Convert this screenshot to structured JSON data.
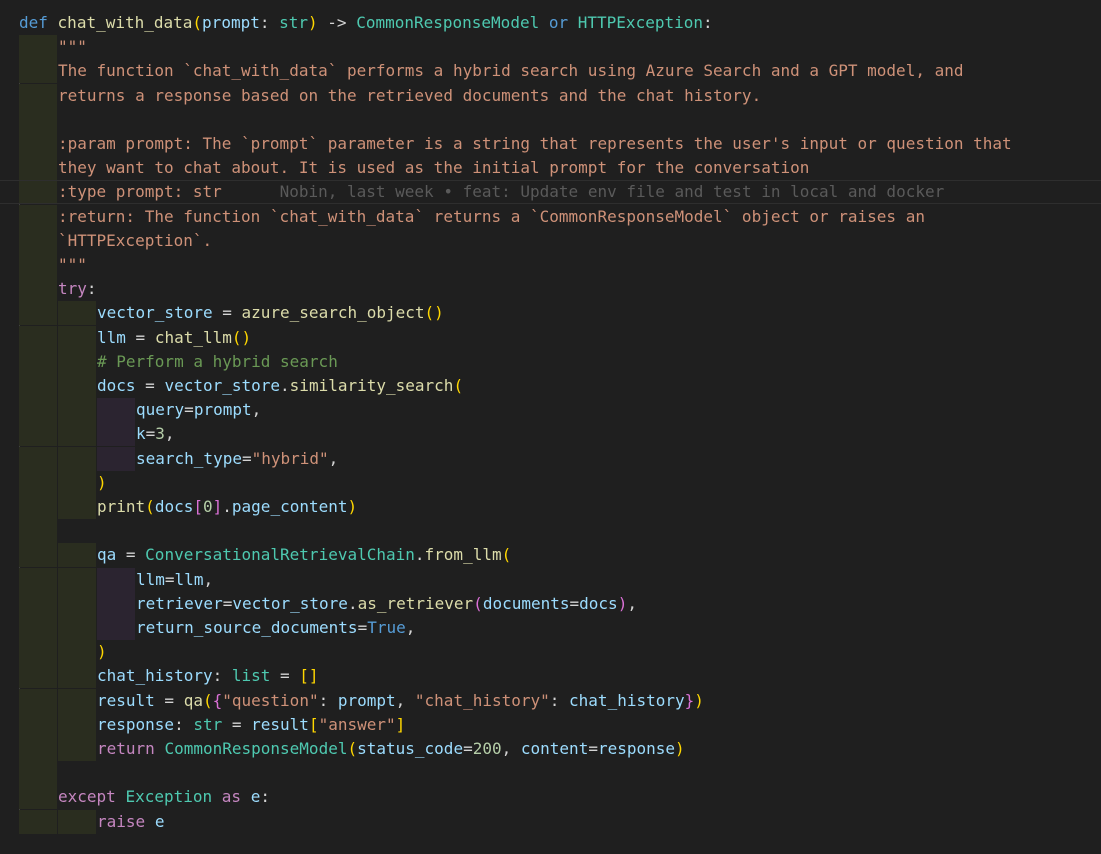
{
  "editor": {
    "language": "python",
    "lines": [
      {
        "indent": 0,
        "tokens": [
          [
            "def",
            "kw"
          ],
          [
            " "
          ],
          [
            "chat_with_data",
            "fn"
          ],
          [
            "(",
            "br1"
          ],
          [
            "prompt",
            "v"
          ],
          [
            ": "
          ],
          [
            "str",
            "cls"
          ],
          [
            ")",
            "br1"
          ],
          [
            " -> "
          ],
          [
            "CommonResponseModel",
            "cls"
          ],
          [
            " "
          ],
          [
            "or",
            "kw"
          ],
          [
            " "
          ],
          [
            "HTTPException",
            "cls"
          ],
          [
            ":"
          ]
        ]
      },
      {
        "indent": 1,
        "tokens": [
          [
            "\"\"\"",
            "str"
          ]
        ]
      },
      {
        "indent": 1,
        "tokens": [
          [
            "The function `chat_with_data` performs a hybrid search using Azure Search and a GPT model, and",
            "str"
          ]
        ]
      },
      {
        "indent": 1,
        "tokens": [
          [
            "returns a response based on the retrieved documents and the chat history.",
            "str"
          ]
        ]
      },
      {
        "indent": 1,
        "tokens": []
      },
      {
        "indent": 1,
        "tokens": [
          [
            ":param prompt: The `prompt` parameter is a string that represents the user's input or question that",
            "str"
          ]
        ]
      },
      {
        "indent": 1,
        "tokens": [
          [
            "they want to chat about. It is used as the initial prompt for the conversation",
            "str"
          ]
        ]
      },
      {
        "indent": 1,
        "current": true,
        "tokens": [
          [
            ":type prompt: str",
            "str"
          ],
          [
            "      Nobin, last week • feat: Update env file and test in local and docker",
            "blame"
          ]
        ]
      },
      {
        "indent": 1,
        "tokens": [
          [
            ":return: The function `chat_with_data` returns a `CommonResponseModel` object or raises an",
            "str"
          ]
        ]
      },
      {
        "indent": 1,
        "tokens": [
          [
            "`HTTPException`.",
            "str"
          ]
        ]
      },
      {
        "indent": 1,
        "tokens": [
          [
            "\"\"\"",
            "str"
          ]
        ]
      },
      {
        "indent": 1,
        "tokens": [
          [
            "try",
            "ctl"
          ],
          [
            ":"
          ]
        ]
      },
      {
        "indent": 2,
        "tokens": [
          [
            "vector_store",
            "v"
          ],
          [
            " = "
          ],
          [
            "azure_search_object",
            "fn"
          ],
          [
            "()",
            "br1"
          ]
        ]
      },
      {
        "indent": 2,
        "tokens": [
          [
            "llm",
            "v"
          ],
          [
            " = "
          ],
          [
            "chat_llm",
            "fn"
          ],
          [
            "()",
            "br1"
          ]
        ]
      },
      {
        "indent": 2,
        "tokens": [
          [
            "# Perform a hybrid search",
            "cm"
          ]
        ]
      },
      {
        "indent": 2,
        "tokens": [
          [
            "docs",
            "v"
          ],
          [
            " = "
          ],
          [
            "vector_store",
            "v"
          ],
          [
            "."
          ],
          [
            "similarity_search",
            "fn"
          ],
          [
            "(",
            "br1"
          ]
        ]
      },
      {
        "indent": 3,
        "tokens": [
          [
            "query",
            "v"
          ],
          [
            "="
          ],
          [
            "prompt",
            "v"
          ],
          [
            ","
          ]
        ]
      },
      {
        "indent": 3,
        "tokens": [
          [
            "k",
            "v"
          ],
          [
            "="
          ],
          [
            "3",
            "num"
          ],
          [
            ","
          ]
        ]
      },
      {
        "indent": 3,
        "tokens": [
          [
            "search_type",
            "v"
          ],
          [
            "="
          ],
          [
            "\"hybrid\"",
            "str"
          ],
          [
            ","
          ]
        ]
      },
      {
        "indent": 2,
        "tokens": [
          [
            ")",
            "br1"
          ]
        ]
      },
      {
        "indent": 2,
        "tokens": [
          [
            "print",
            "fn"
          ],
          [
            "(",
            "br1"
          ],
          [
            "docs",
            "v"
          ],
          [
            "[",
            "br2"
          ],
          [
            "0",
            "num"
          ],
          [
            "]",
            "br2"
          ],
          [
            "."
          ],
          [
            "page_content",
            "v"
          ],
          [
            ")",
            "br1"
          ]
        ]
      },
      {
        "indent": 2,
        "tokens": []
      },
      {
        "indent": 2,
        "tokens": [
          [
            "qa",
            "v"
          ],
          [
            " = "
          ],
          [
            "ConversationalRetrievalChain",
            "cls"
          ],
          [
            "."
          ],
          [
            "from_llm",
            "fn"
          ],
          [
            "(",
            "br1"
          ]
        ]
      },
      {
        "indent": 3,
        "tokens": [
          [
            "llm",
            "v"
          ],
          [
            "="
          ],
          [
            "llm",
            "v"
          ],
          [
            ","
          ]
        ]
      },
      {
        "indent": 3,
        "tokens": [
          [
            "retriever",
            "v"
          ],
          [
            "="
          ],
          [
            "vector_store",
            "v"
          ],
          [
            "."
          ],
          [
            "as_retriever",
            "fn"
          ],
          [
            "(",
            "br2"
          ],
          [
            "documents",
            "v"
          ],
          [
            "="
          ],
          [
            "docs",
            "v"
          ],
          [
            ")",
            "br2"
          ],
          [
            ","
          ]
        ]
      },
      {
        "indent": 3,
        "tokens": [
          [
            "return_source_documents",
            "v"
          ],
          [
            "="
          ],
          [
            "True",
            "kw"
          ],
          [
            ","
          ]
        ]
      },
      {
        "indent": 2,
        "tokens": [
          [
            ")",
            "br1"
          ]
        ]
      },
      {
        "indent": 2,
        "tokens": [
          [
            "chat_history",
            "v"
          ],
          [
            ": "
          ],
          [
            "list",
            "cls"
          ],
          [
            " = "
          ],
          [
            "[]",
            "br1"
          ]
        ]
      },
      {
        "indent": 2,
        "tokens": [
          [
            "result",
            "v"
          ],
          [
            " = "
          ],
          [
            "qa",
            "fn"
          ],
          [
            "(",
            "br1"
          ],
          [
            "{",
            "br2"
          ],
          [
            "\"question\"",
            "str"
          ],
          [
            ": "
          ],
          [
            "prompt",
            "v"
          ],
          [
            ", "
          ],
          [
            "\"chat_history\"",
            "str"
          ],
          [
            ": "
          ],
          [
            "chat_history",
            "v"
          ],
          [
            "}",
            "br2"
          ],
          [
            ")",
            "br1"
          ]
        ]
      },
      {
        "indent": 2,
        "tokens": [
          [
            "response",
            "v"
          ],
          [
            ": "
          ],
          [
            "str",
            "cls"
          ],
          [
            " = "
          ],
          [
            "result",
            "v"
          ],
          [
            "[",
            "br1"
          ],
          [
            "\"answer\"",
            "str"
          ],
          [
            "]",
            "br1"
          ]
        ]
      },
      {
        "indent": 2,
        "tokens": [
          [
            "return",
            "ctl"
          ],
          [
            " "
          ],
          [
            "CommonResponseModel",
            "cls"
          ],
          [
            "(",
            "br1"
          ],
          [
            "status_code",
            "v"
          ],
          [
            "="
          ],
          [
            "200",
            "num"
          ],
          [
            ", "
          ],
          [
            "content",
            "v"
          ],
          [
            "="
          ],
          [
            "response",
            "v"
          ],
          [
            ")",
            "br1"
          ]
        ]
      },
      {
        "indent": 1,
        "tokens": []
      },
      {
        "indent": 1,
        "tokens": [
          [
            "except",
            "ctl"
          ],
          [
            " "
          ],
          [
            "Exception",
            "cls"
          ],
          [
            " "
          ],
          [
            "as",
            "ctl"
          ],
          [
            " "
          ],
          [
            "e",
            "v"
          ],
          [
            ":"
          ]
        ]
      },
      {
        "indent": 2,
        "tokens": [
          [
            "raise",
            "ctl"
          ],
          [
            " "
          ],
          [
            "e",
            "v"
          ]
        ]
      }
    ]
  }
}
